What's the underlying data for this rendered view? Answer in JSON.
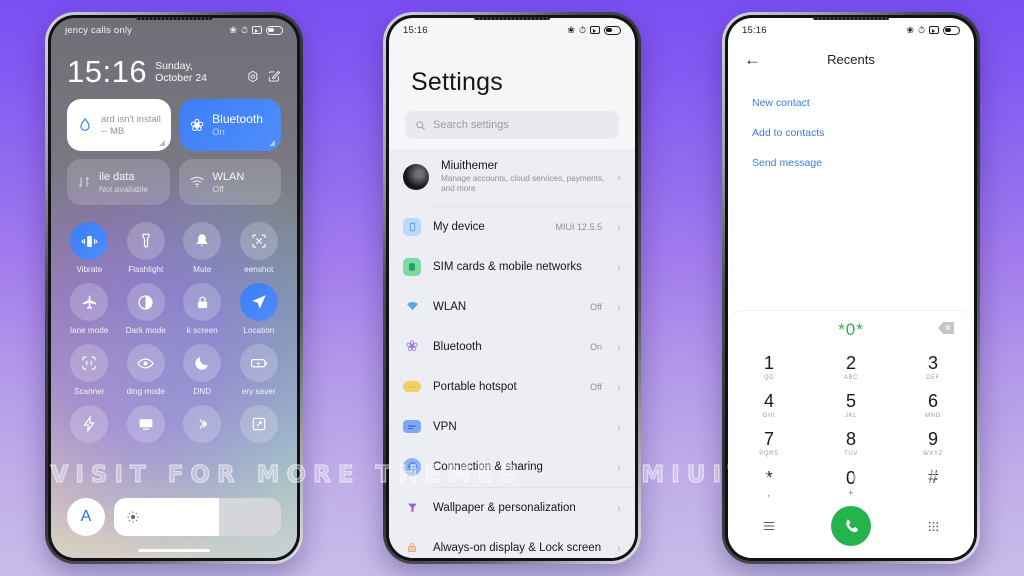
{
  "background": {
    "gradient_top": "#7a4ff2",
    "gradient_bottom": "#c7bde9"
  },
  "watermark": {
    "line1": "VISIT FOR MORE THEMES",
    "line2": "MIUITHEMER.COM"
  },
  "accent_colors": {
    "blue": "#3e7ef7",
    "green": "#24b34c",
    "link_blue": "#3b7ddd",
    "dialer_green": "#2cb34a"
  },
  "phone1": {
    "name": "control-center",
    "statusbar": {
      "carrier": "jency calls only",
      "icons": [
        "bluetooth-icon",
        "alarm-icon",
        "screenshot-icon",
        "battery-icon"
      ]
    },
    "clock": {
      "time": "15:16",
      "date": "Sunday, October 24"
    },
    "header_icons": [
      "settings-gear-icon",
      "edit-icon"
    ],
    "cards": [
      {
        "icon": "water-drop-icon",
        "title": "ard isn't install",
        "subtitle": "-- MB",
        "state": "light"
      },
      {
        "icon": "bluetooth-icon",
        "title": "Bluetooth",
        "subtitle": "On",
        "state": "blue"
      }
    ],
    "cards2": [
      {
        "icon": "data-transfer-icon",
        "title": "ile data",
        "subtitle": "Not available"
      },
      {
        "icon": "wifi-icon",
        "title": "WLAN",
        "subtitle": "Off"
      }
    ],
    "tiles": [
      {
        "label": "Vibrate",
        "icon": "vibrate-icon",
        "on": true
      },
      {
        "label": "Flashlight",
        "icon": "flashlight-icon",
        "on": false
      },
      {
        "label": "Mute",
        "icon": "bell-icon",
        "on": false
      },
      {
        "label": "eenshot",
        "icon": "screenshot-icon",
        "on": false
      },
      {
        "label": "lane mode",
        "icon": "airplane-icon",
        "on": false
      },
      {
        "label": "Dark mode",
        "icon": "dark-mode-icon",
        "on": false
      },
      {
        "label": "k screen",
        "icon": "lock-icon",
        "on": false
      },
      {
        "label": "Location",
        "icon": "location-icon",
        "on": true
      },
      {
        "label": "Scanner",
        "icon": "scanner-icon",
        "on": false
      },
      {
        "label": "ding mode",
        "icon": "eye-icon",
        "on": false
      },
      {
        "label": "DND",
        "icon": "moon-icon",
        "on": false
      },
      {
        "label": "ery saver",
        "icon": "battery-saver-icon",
        "on": false
      },
      {
        "label": "",
        "icon": "lightning-icon",
        "on": false
      },
      {
        "label": "",
        "icon": "cast-icon",
        "on": false
      },
      {
        "label": "",
        "icon": "mi-share-icon",
        "on": false
      },
      {
        "label": "",
        "icon": "sync-icon",
        "on": false
      }
    ],
    "brightness": {
      "auto_label": "A",
      "icon": "brightness-icon",
      "level_percent": 63
    }
  },
  "phone2": {
    "name": "settings",
    "statusbar": {
      "time": "15:16",
      "icons": [
        "bluetooth-icon",
        "alarm-icon",
        "screenshot-icon",
        "battery-icon"
      ]
    },
    "title": "Settings",
    "search": {
      "placeholder": "Search settings",
      "icon": "search-icon"
    },
    "rows": [
      {
        "title": "Miuithemer",
        "subtitle": "Manage accounts, cloud services, payments, and more",
        "value": "",
        "icon": "account-avatar",
        "icon_color": "#1a1a1c",
        "type": "account"
      },
      {
        "title": "My device",
        "subtitle": "",
        "value": "MIUI 12.5.5",
        "icon": "phone-icon",
        "icon_color": "#bcd8fb"
      },
      {
        "title": "SIM cards & mobile networks",
        "subtitle": "",
        "value": "",
        "icon": "sim-icon",
        "icon_color": "#7cd9a0"
      },
      {
        "title": "WLAN",
        "subtitle": "",
        "value": "Off",
        "icon": "wifi-icon",
        "icon_color": "#66a6f5"
      },
      {
        "title": "Bluetooth",
        "subtitle": "",
        "value": "On",
        "icon": "bluetooth-icon",
        "icon_color": "#9b7cf0"
      },
      {
        "title": "Portable hotspot",
        "subtitle": "",
        "value": "Off",
        "icon": "hotspot-icon",
        "icon_color": "#f2cf63"
      },
      {
        "title": "VPN",
        "subtitle": "",
        "value": "",
        "icon": "vpn-icon",
        "icon_color": "#7fa9f2"
      },
      {
        "title": "Connection & sharing",
        "subtitle": "",
        "value": "",
        "icon": "connection-icon",
        "icon_color": "#8fb4f5"
      },
      {
        "title": "Wallpaper & personalization",
        "subtitle": "",
        "value": "",
        "icon": "wallpaper-icon",
        "icon_color": "#9b5fe0"
      },
      {
        "title": "Always-on display & Lock screen",
        "subtitle": "",
        "value": "",
        "icon": "lock-icon",
        "icon_color": "#f2b183"
      }
    ]
  },
  "phone3": {
    "name": "dialer-recents",
    "statusbar": {
      "time": "15:16",
      "icons": [
        "bluetooth-icon",
        "alarm-icon",
        "screenshot-icon",
        "battery-icon"
      ]
    },
    "header": {
      "back_icon": "back-arrow-icon",
      "title": "Recents"
    },
    "links": [
      {
        "label": "New contact"
      },
      {
        "label": "Add to contacts"
      },
      {
        "label": "Send message"
      }
    ],
    "dialpad": {
      "number": "*0*",
      "delete_icon": "backspace-icon",
      "keys": [
        {
          "digit": "1",
          "sub": "QD"
        },
        {
          "digit": "2",
          "sub": "ABC"
        },
        {
          "digit": "3",
          "sub": "DEF"
        },
        {
          "digit": "4",
          "sub": "GHI"
        },
        {
          "digit": "5",
          "sub": "JKL"
        },
        {
          "digit": "6",
          "sub": "MNO"
        },
        {
          "digit": "7",
          "sub": "PQRS"
        },
        {
          "digit": "8",
          "sub": "TUV"
        },
        {
          "digit": "9",
          "sub": "WXYZ"
        },
        {
          "digit": "*",
          "sub": ","
        },
        {
          "digit": "0",
          "sub": "+"
        },
        {
          "digit": "#",
          "sub": ""
        }
      ],
      "actions": {
        "left_icon": "menu-lines-icon",
        "call_icon": "phone-call-icon",
        "right_icon": "keypad-grid-icon"
      }
    }
  }
}
